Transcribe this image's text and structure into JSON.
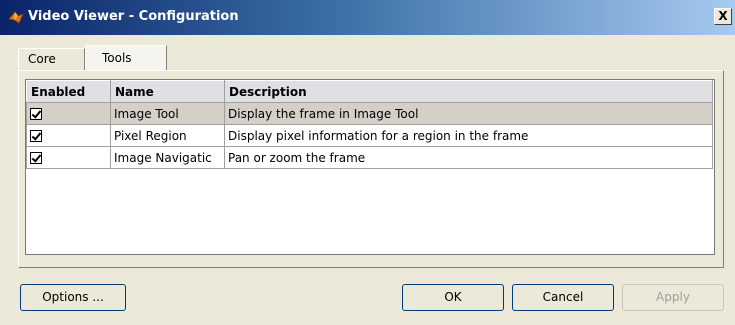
{
  "window": {
    "title": "Video Viewer - Configuration",
    "close_label": "X"
  },
  "tabs": [
    {
      "label": "Core",
      "active": false
    },
    {
      "label": "Tools",
      "active": true
    }
  ],
  "table": {
    "headers": [
      "Enabled",
      "Name",
      "Description"
    ],
    "rows": [
      {
        "enabled": true,
        "name": "Image Tool",
        "description": "Display the frame in Image Tool"
      },
      {
        "enabled": true,
        "name": "Pixel Region",
        "description": "Display pixel information for a region in the frame"
      },
      {
        "enabled": true,
        "name": "Image Navigatic",
        "description": "Pan or zoom the frame"
      }
    ]
  },
  "buttons": {
    "options": "Options ...",
    "ok": "OK",
    "cancel": "Cancel",
    "apply": "Apply"
  },
  "colors": {
    "title_start": "#0a246a",
    "title_end": "#a6caf0",
    "dialog_bg": "#ece9d8"
  },
  "icons": {
    "app": "matlab-icon",
    "close": "close-icon",
    "checkbox": "checkbox-checked-icon"
  }
}
